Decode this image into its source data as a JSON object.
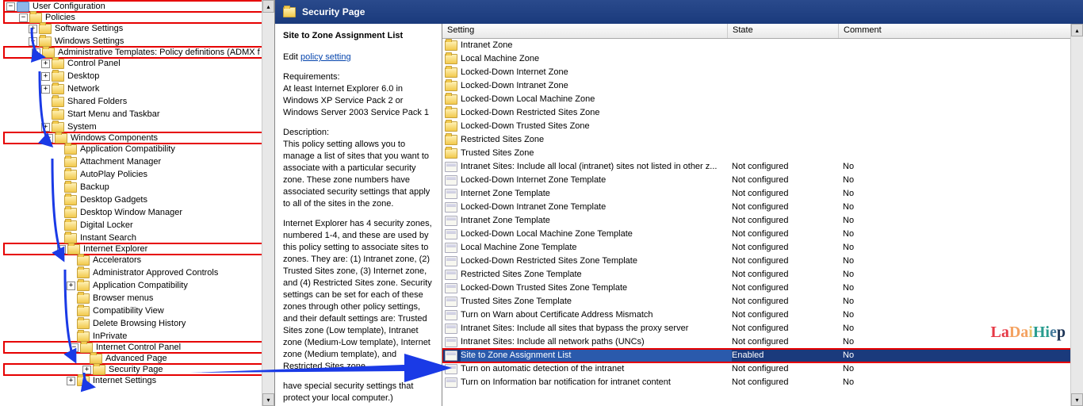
{
  "header": {
    "title": "Security Page"
  },
  "tree": {
    "root": "User Configuration",
    "policies": "Policies",
    "software": "Software Settings",
    "windows_settings": "Windows Settings",
    "admx": "Administrative Templates: Policy definitions (ADMX f",
    "control_panel": "Control Panel",
    "desktop": "Desktop",
    "network": "Network",
    "shared_folders": "Shared Folders",
    "start_menu": "Start Menu and Taskbar",
    "system": "System",
    "win_components": "Windows Components",
    "app_compat": "Application Compatibility",
    "attach_mgr": "Attachment Manager",
    "autoplay": "AutoPlay Policies",
    "backup": "Backup",
    "desk_gadgets": "Desktop Gadgets",
    "desk_win_mgr": "Desktop Window Manager",
    "digital_locker": "Digital Locker",
    "instant_search": "Instant Search",
    "ie": "Internet Explorer",
    "accelerators": "Accelerators",
    "admin_controls": "Administrator Approved Controls",
    "app_compat2": "Application Compatibility",
    "browser_menus": "Browser menus",
    "compat_view": "Compatibility View",
    "del_history": "Delete Browsing History",
    "inprivate": "InPrivate",
    "ie_cp": "Internet Control Panel",
    "adv_page": "Advanced Page",
    "sec_page": "Security Page",
    "ie_settings": "Internet Settings"
  },
  "detail": {
    "title": "Site to Zone Assignment List",
    "edit_prefix": "Edit ",
    "edit_link": "policy setting",
    "req_label": "Requirements:",
    "req_text": "At least Internet Explorer 6.0 in Windows XP Service Pack 2 or Windows Server 2003 Service Pack 1",
    "desc_label": "Description:",
    "desc_p1": "This policy setting allows you to manage a list of sites that you want to associate with a particular security zone. These zone numbers have associated security settings that apply to all of the sites in the zone.",
    "desc_p2": "Internet Explorer has 4 security zones, numbered 1-4, and these are used by this policy setting to associate sites to zones. They are: (1) Intranet zone, (2) Trusted Sites zone, (3) Internet zone, and (4) Restricted Sites zone. Security settings can be set for each of these zones through other policy settings, and their default settings are: Trusted Sites zone (Low template), Intranet zone (Medium-Low template), Internet zone (Medium template), and Restricted Sites zone",
    "desc_p3": "have special security settings that protect your local computer.)"
  },
  "columns": {
    "setting": "Setting",
    "state": "State",
    "comment": "Comment"
  },
  "folders": [
    "Intranet Zone",
    "Local Machine Zone",
    "Locked-Down Internet Zone",
    "Locked-Down Intranet Zone",
    "Locked-Down Local Machine Zone",
    "Locked-Down Restricted Sites Zone",
    "Locked-Down Trusted Sites Zone",
    "Restricted Sites Zone",
    "Trusted Sites Zone"
  ],
  "settings": [
    {
      "n": "Intranet Sites: Include all local (intranet) sites not listed in other z...",
      "s": "Not configured",
      "c": "No"
    },
    {
      "n": "Locked-Down Internet Zone Template",
      "s": "Not configured",
      "c": "No"
    },
    {
      "n": "Internet Zone Template",
      "s": "Not configured",
      "c": "No"
    },
    {
      "n": "Locked-Down Intranet Zone Template",
      "s": "Not configured",
      "c": "No"
    },
    {
      "n": "Intranet Zone Template",
      "s": "Not configured",
      "c": "No"
    },
    {
      "n": "Locked-Down Local Machine Zone Template",
      "s": "Not configured",
      "c": "No"
    },
    {
      "n": "Local Machine Zone Template",
      "s": "Not configured",
      "c": "No"
    },
    {
      "n": "Locked-Down Restricted Sites Zone Template",
      "s": "Not configured",
      "c": "No"
    },
    {
      "n": "Restricted Sites Zone Template",
      "s": "Not configured",
      "c": "No"
    },
    {
      "n": "Locked-Down Trusted Sites Zone Template",
      "s": "Not configured",
      "c": "No"
    },
    {
      "n": "Trusted Sites Zone Template",
      "s": "Not configured",
      "c": "No"
    },
    {
      "n": "Turn on Warn about Certificate Address Mismatch",
      "s": "Not configured",
      "c": "No"
    },
    {
      "n": "Intranet Sites: Include all sites that bypass the proxy server",
      "s": "Not configured",
      "c": "No"
    },
    {
      "n": "Intranet Sites: Include all network paths (UNCs)",
      "s": "Not configured",
      "c": "No"
    },
    {
      "n": "Site to Zone Assignment List",
      "s": "Enabled",
      "c": "No",
      "sel": true
    },
    {
      "n": "Turn on automatic detection of the intranet",
      "s": "Not configured",
      "c": "No"
    },
    {
      "n": "Turn on Information bar notification for intranet content",
      "s": "Not configured",
      "c": "No"
    }
  ],
  "watermark": "LaDaiHiep"
}
